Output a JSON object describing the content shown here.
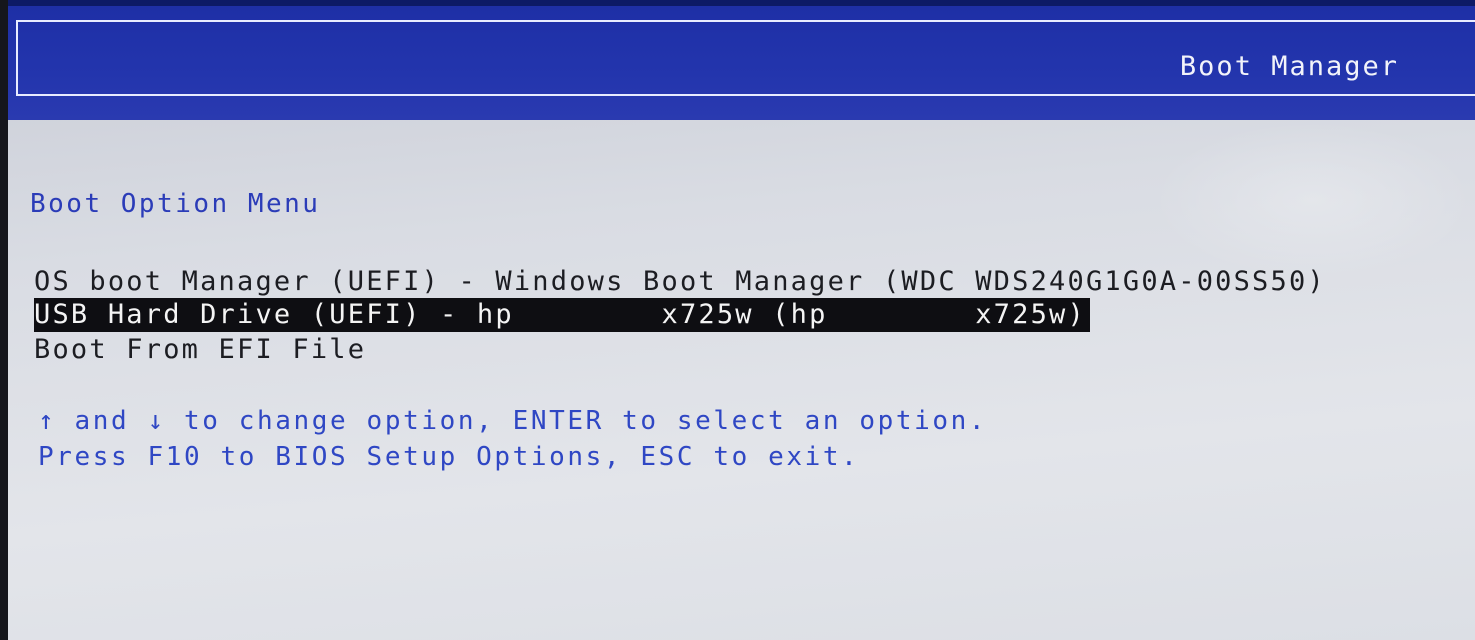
{
  "header": {
    "title": "Boot Manager"
  },
  "menu": {
    "title": "Boot Option Menu",
    "options": [
      {
        "label": "OS boot Manager (UEFI) - Windows Boot Manager (WDC WDS240G1G0A-00SS50)",
        "selected": false
      },
      {
        "label": "USB Hard Drive (UEFI) - hp        x725w (hp        x725w)",
        "selected": true
      },
      {
        "label": "Boot From EFI File",
        "selected": false
      }
    ]
  },
  "help": {
    "line1": "↑ and ↓ to change option, ENTER to select an option.",
    "line2": "Press F10 to BIOS Setup Options, ESC to exit."
  },
  "colors": {
    "header_bg": "#2335ad",
    "header_text": "#f2f3fa",
    "menu_title": "#2b3cb8",
    "help_text": "#2f47c4",
    "body_bg": "#dcdfe5",
    "selection_bg": "#0e0e12",
    "selection_text": "#f4f4f4"
  }
}
